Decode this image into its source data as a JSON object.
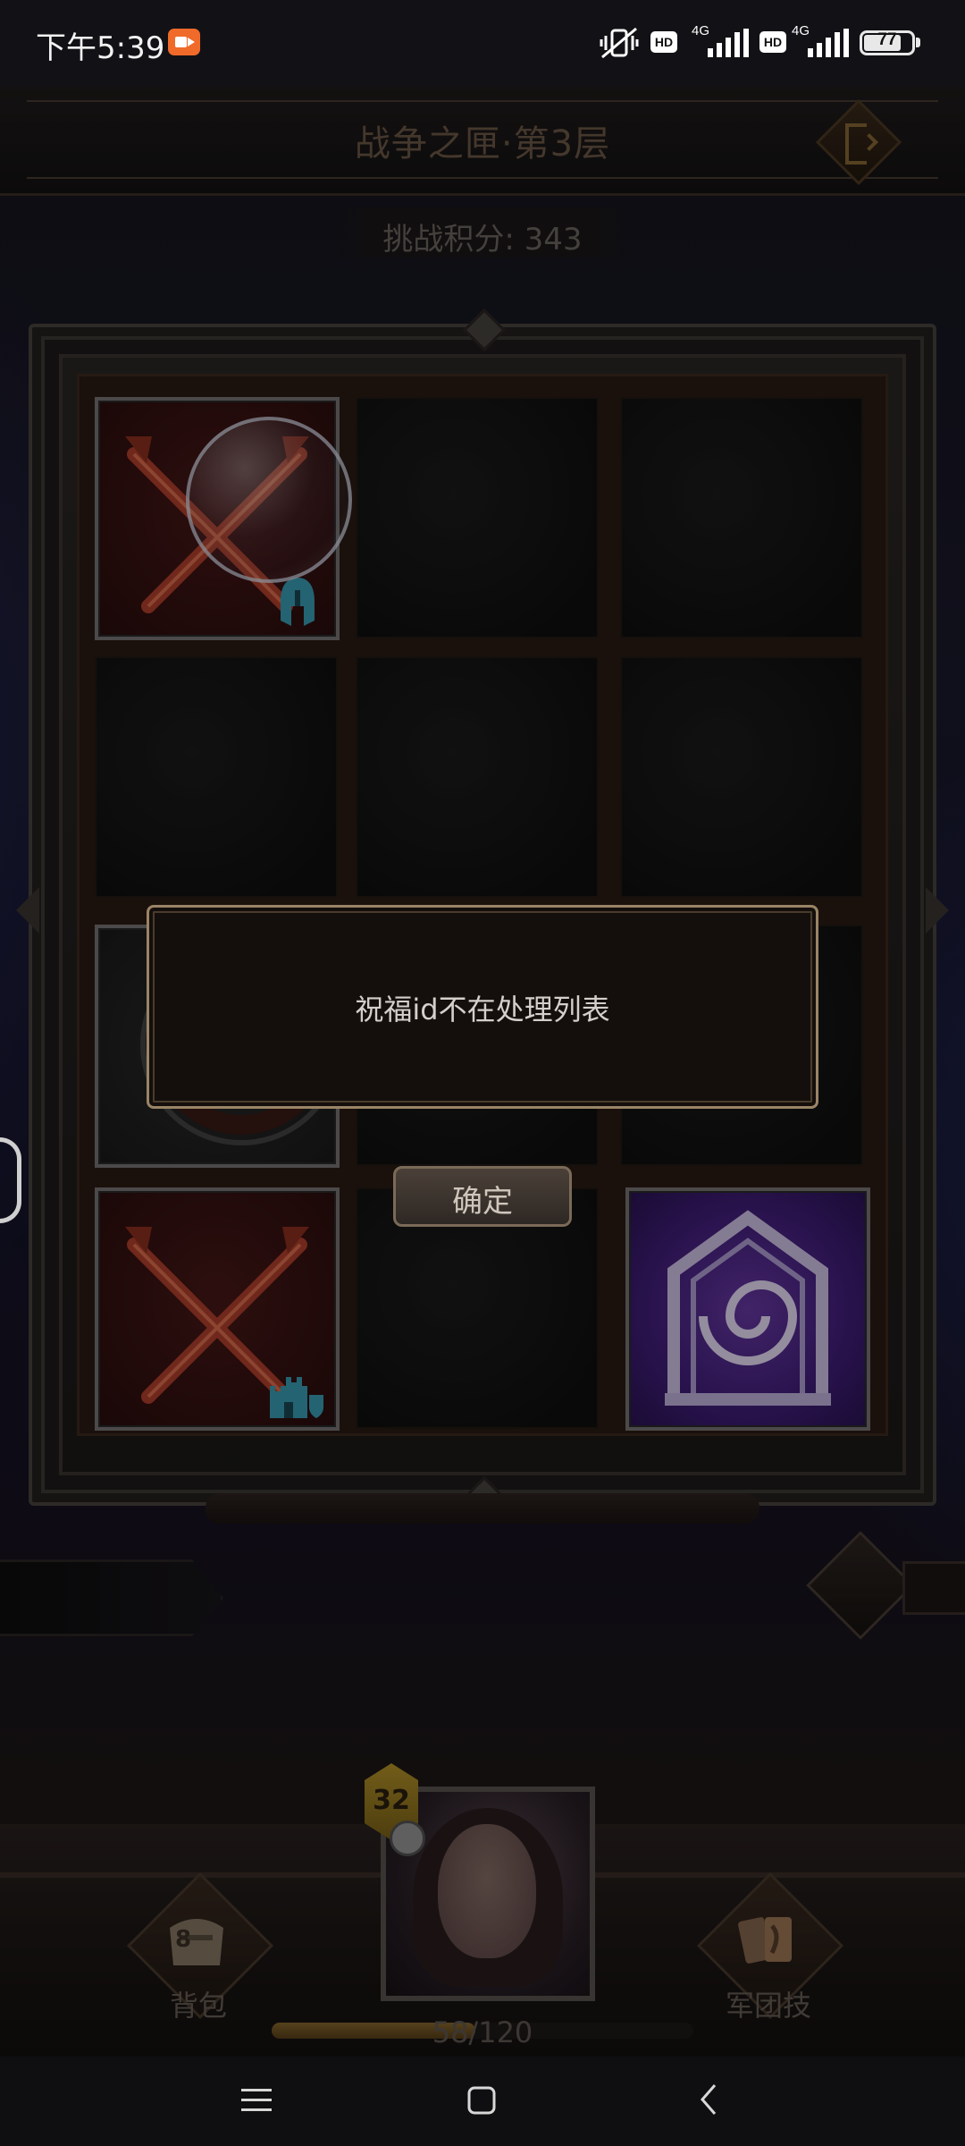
{
  "status_bar": {
    "time": "下午5:39",
    "network_left": "4G",
    "network_right": "4G",
    "hd_label": "HD",
    "battery": "77"
  },
  "header": {
    "title": "战争之匣·第3层",
    "score_label": "挑战积分: 343"
  },
  "board": {
    "rows": 4,
    "cols": 3,
    "tiles": [
      {
        "row": 0,
        "col": 0,
        "kind": "crossed-swords-icon",
        "badge": "helmet-icon"
      },
      {
        "row": 2,
        "col": 0,
        "kind": "gray-tile"
      },
      {
        "row": 3,
        "col": 0,
        "kind": "crossed-swords-icon",
        "badge": "castle-icon"
      },
      {
        "row": 3,
        "col": 2,
        "kind": "portal-icon"
      }
    ]
  },
  "dialog": {
    "message": "祝福id不在处理列表",
    "confirm_label": "确定"
  },
  "bottom": {
    "bag_label": "背包",
    "bag_count": "8",
    "legion_skill_label": "军团技",
    "level": "32",
    "xp_text": "58/120",
    "xp_current": 58,
    "xp_max": 120
  },
  "system_nav": {
    "menu_icon": "menu-icon",
    "home_icon": "home-icon",
    "back_icon": "back-icon"
  },
  "colors": {
    "title": "#6e5a47",
    "dialog_border": "#9a8466",
    "tile_red": "#4a1818",
    "tile_purple": "#6a3aa8",
    "badge_teal": "#3aa0b8"
  }
}
